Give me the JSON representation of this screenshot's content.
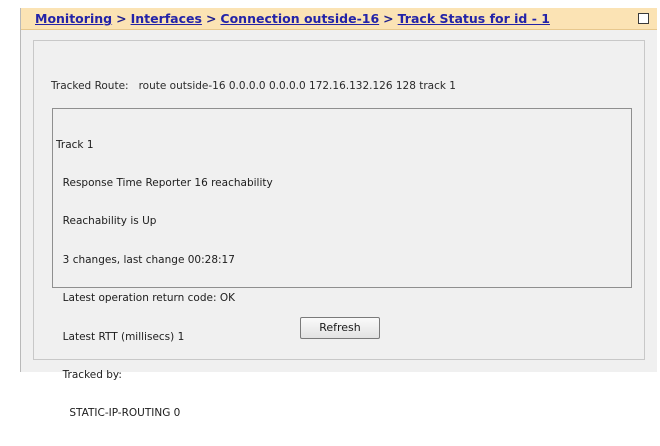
{
  "breadcrumb": {
    "items": [
      {
        "label": "Monitoring"
      },
      {
        "label": "Interfaces"
      },
      {
        "label": "Connection outside-16"
      },
      {
        "label": "Track Status for id - 1"
      }
    ],
    "separator": ">"
  },
  "tracked_route": {
    "label": "Tracked Route:",
    "value": "route outside-16 0.0.0.0 0.0.0.0 172.16.132.126 128  track 1"
  },
  "status": {
    "lines": [
      "Track 1",
      "  Response Time Reporter 16 reachability",
      "  Reachability is Up",
      "  3 changes, last change 00:28:17",
      "  Latest operation return code: OK",
      "  Latest RTT (millisecs) 1",
      "  Tracked by:",
      "    STATIC-IP-ROUTING 0"
    ]
  },
  "actions": {
    "refresh_label": "Refresh"
  },
  "colors": {
    "titlebar_bg": "#fbe3b4",
    "link": "#2323a8",
    "panel_bg": "#f0f0f0"
  },
  "icons": {
    "maximize": "maximize-icon"
  }
}
